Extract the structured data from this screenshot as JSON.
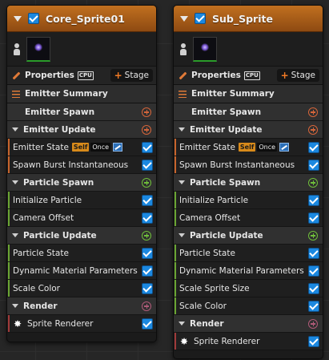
{
  "emitters": [
    {
      "title": "Core_Sprite01",
      "properties_label": "Properties",
      "cpu_label": "CPU",
      "stage_label": "Stage",
      "summary_label": "Emitter Summary",
      "emitter_spawn_label": "Emitter Spawn",
      "emitter_update_label": "Emitter Update",
      "emitter_update_modules": [
        {
          "label": "Emitter State",
          "self": "Self",
          "once": "Once"
        },
        {
          "label": "Spawn Burst Instantaneous"
        }
      ],
      "particle_spawn_label": "Particle Spawn",
      "particle_spawn_modules": [
        {
          "label": "Initialize Particle"
        },
        {
          "label": "Camera Offset"
        }
      ],
      "particle_update_label": "Particle Update",
      "particle_update_modules": [
        {
          "label": "Particle State"
        },
        {
          "label": "Dynamic Material Parameters"
        },
        {
          "label": "Scale Color"
        }
      ],
      "render_label": "Render",
      "render_modules": [
        {
          "label": "Sprite Renderer"
        }
      ]
    },
    {
      "title": "Sub_Sprite",
      "properties_label": "Properties",
      "cpu_label": "CPU",
      "stage_label": "Stage",
      "summary_label": "Emitter Summary",
      "emitter_spawn_label": "Emitter Spawn",
      "emitter_update_label": "Emitter Update",
      "emitter_update_modules": [
        {
          "label": "Emitter State",
          "self": "Self",
          "once": "Once"
        },
        {
          "label": "Spawn Burst Instantaneous"
        }
      ],
      "particle_spawn_label": "Particle Spawn",
      "particle_spawn_modules": [
        {
          "label": "Initialize Particle"
        },
        {
          "label": "Camera Offset"
        }
      ],
      "particle_update_label": "Particle Update",
      "particle_update_modules": [
        {
          "label": "Particle State"
        },
        {
          "label": "Dynamic Material Parameters"
        },
        {
          "label": "Scale Sprite Size"
        },
        {
          "label": "Scale Color"
        }
      ],
      "render_label": "Render",
      "render_modules": [
        {
          "label": "Sprite Renderer"
        }
      ]
    }
  ],
  "colors": {
    "title_bar": "#c1701f",
    "checkbox": "#1b88e0",
    "emitter_stage": "#d5653a",
    "particle_stage": "#6fbf3a",
    "render_stage": "#b05a78"
  },
  "icons": {
    "collapse": "chevron-down-icon",
    "enabled": "checkbox-checked-icon",
    "properties": "pencil-icon",
    "summary": "list-icon",
    "add": "plus-circle-icon",
    "sprite": "sprite-star-icon",
    "curve": "curve-chart-icon",
    "preview": "person-icon"
  }
}
